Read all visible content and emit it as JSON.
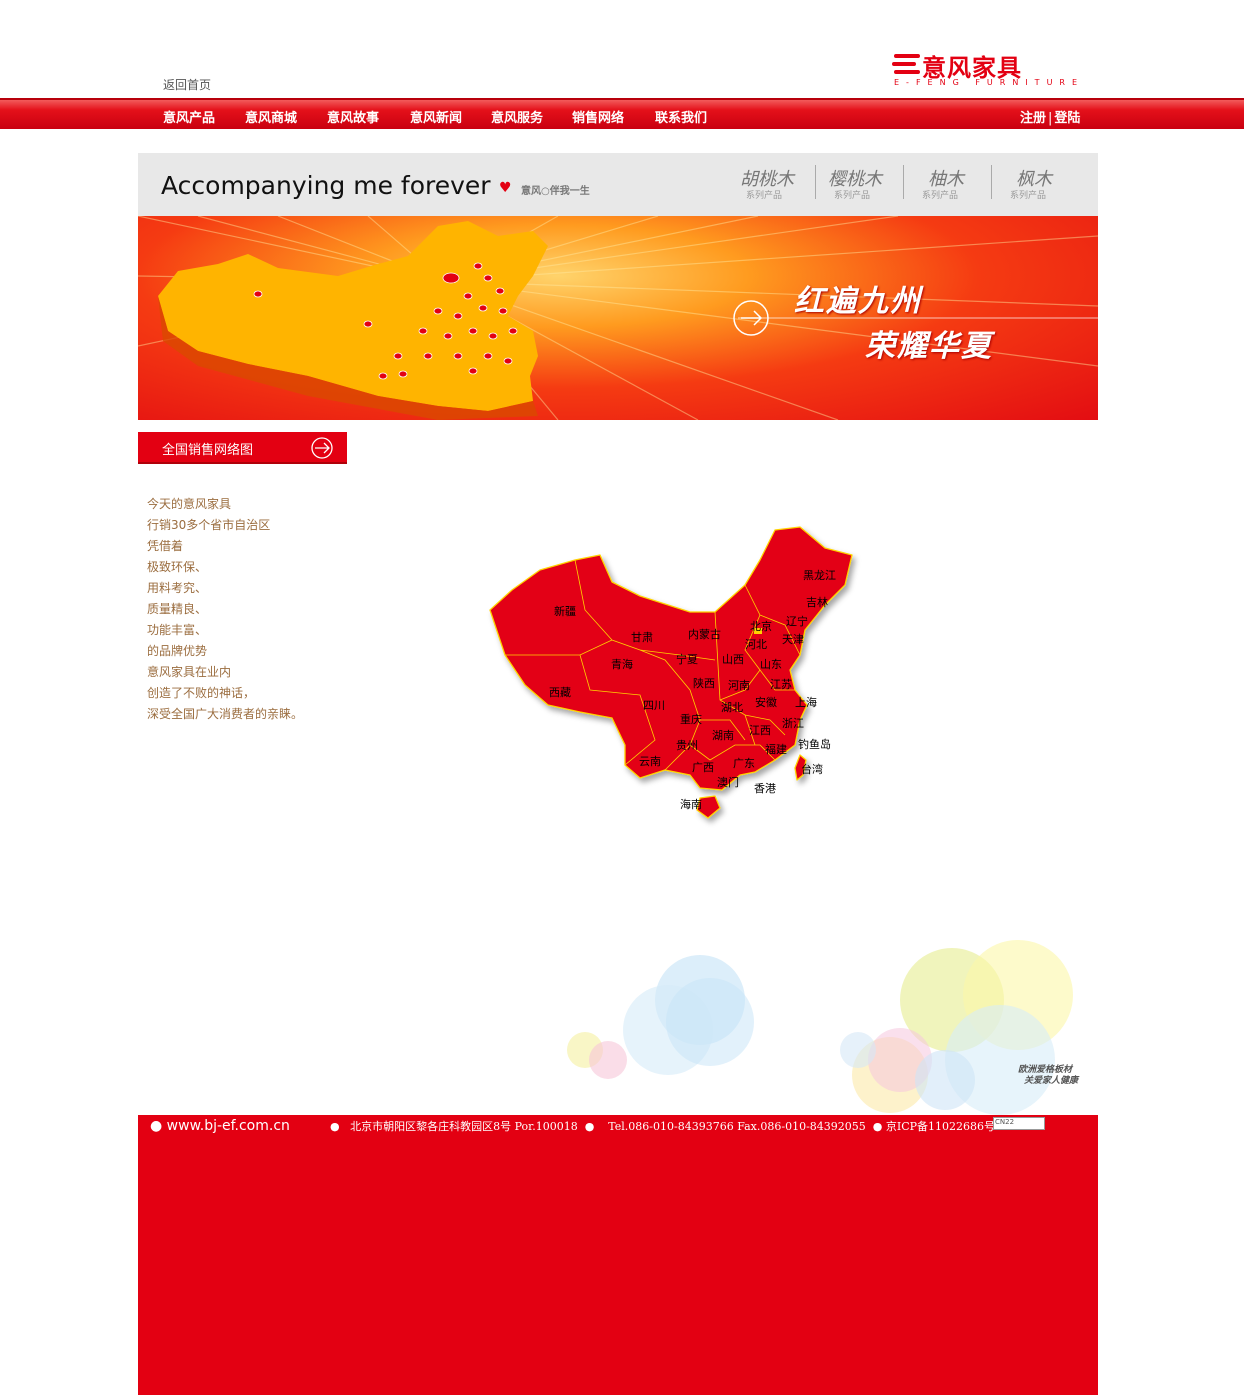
{
  "header": {
    "home_link": "返回首页",
    "logo_cn": "意风家具",
    "logo_en": "E-FENG FURNITURE"
  },
  "nav": {
    "items": [
      "意风产品",
      "意风商城",
      "意风故事",
      "意风新闻",
      "意风服务",
      "销售网络",
      "联系我们"
    ],
    "register": "注册",
    "separator": "|",
    "login": "登陆"
  },
  "banner": {
    "slogan_en": "Accompanying me forever",
    "slogan_cn": "意风○伴我一生",
    "series": [
      {
        "name": "胡桃木",
        "sub": "系列产品"
      },
      {
        "name": "樱桃木",
        "sub": "系列产品"
      },
      {
        "name": "柚木",
        "sub": "系列产品"
      },
      {
        "name": "枫木",
        "sub": "系列产品"
      }
    ],
    "headline_1": "红遍九州",
    "headline_2": "荣耀华夏"
  },
  "section": {
    "title": "全国销售网络图"
  },
  "intro": [
    "今天的意风家具",
    "行销30多个省市自治区",
    "凭借着",
    "极致环保、",
    "用料考究、",
    "质量精良、",
    "功能丰富、",
    "的品牌优势",
    "意风家具在业内",
    "创造了不败的神话，",
    "深受全国广大消费者的亲睐。"
  ],
  "map": {
    "labels": [
      "黑龙江",
      "吉林",
      "辽宁",
      "北京",
      "天津",
      "河北",
      "内蒙古",
      "新疆",
      "甘肃",
      "宁夏",
      "山西",
      "山东",
      "青海",
      "陕西",
      "河南",
      "江苏",
      "西藏",
      "四川",
      "湖北",
      "安徽",
      "上海",
      "重庆",
      "浙江",
      "江西",
      "贵州",
      "湖南",
      "福建",
      "钓鱼岛",
      "云南",
      "广西",
      "广东",
      "台湾",
      "澳门",
      "香港",
      "海南"
    ]
  },
  "footer": {
    "site_url": "www.bj-ef.com.cn",
    "address": "北京市朝阳区黎各庄科教园区8号 Por.100018",
    "tel": "Tel.086-010-84393766 Fax.086-010-84392055",
    "icp": "京ICP备11022686号-1",
    "badge": "CN22",
    "bubble_text_1": "欧洲爱格板材",
    "bubble_text_2": "关爱家人健康"
  },
  "colors": {
    "brand_red": "#e30012",
    "intro_text": "#9b6d3f",
    "banner_grey": "#e8e8e8"
  }
}
